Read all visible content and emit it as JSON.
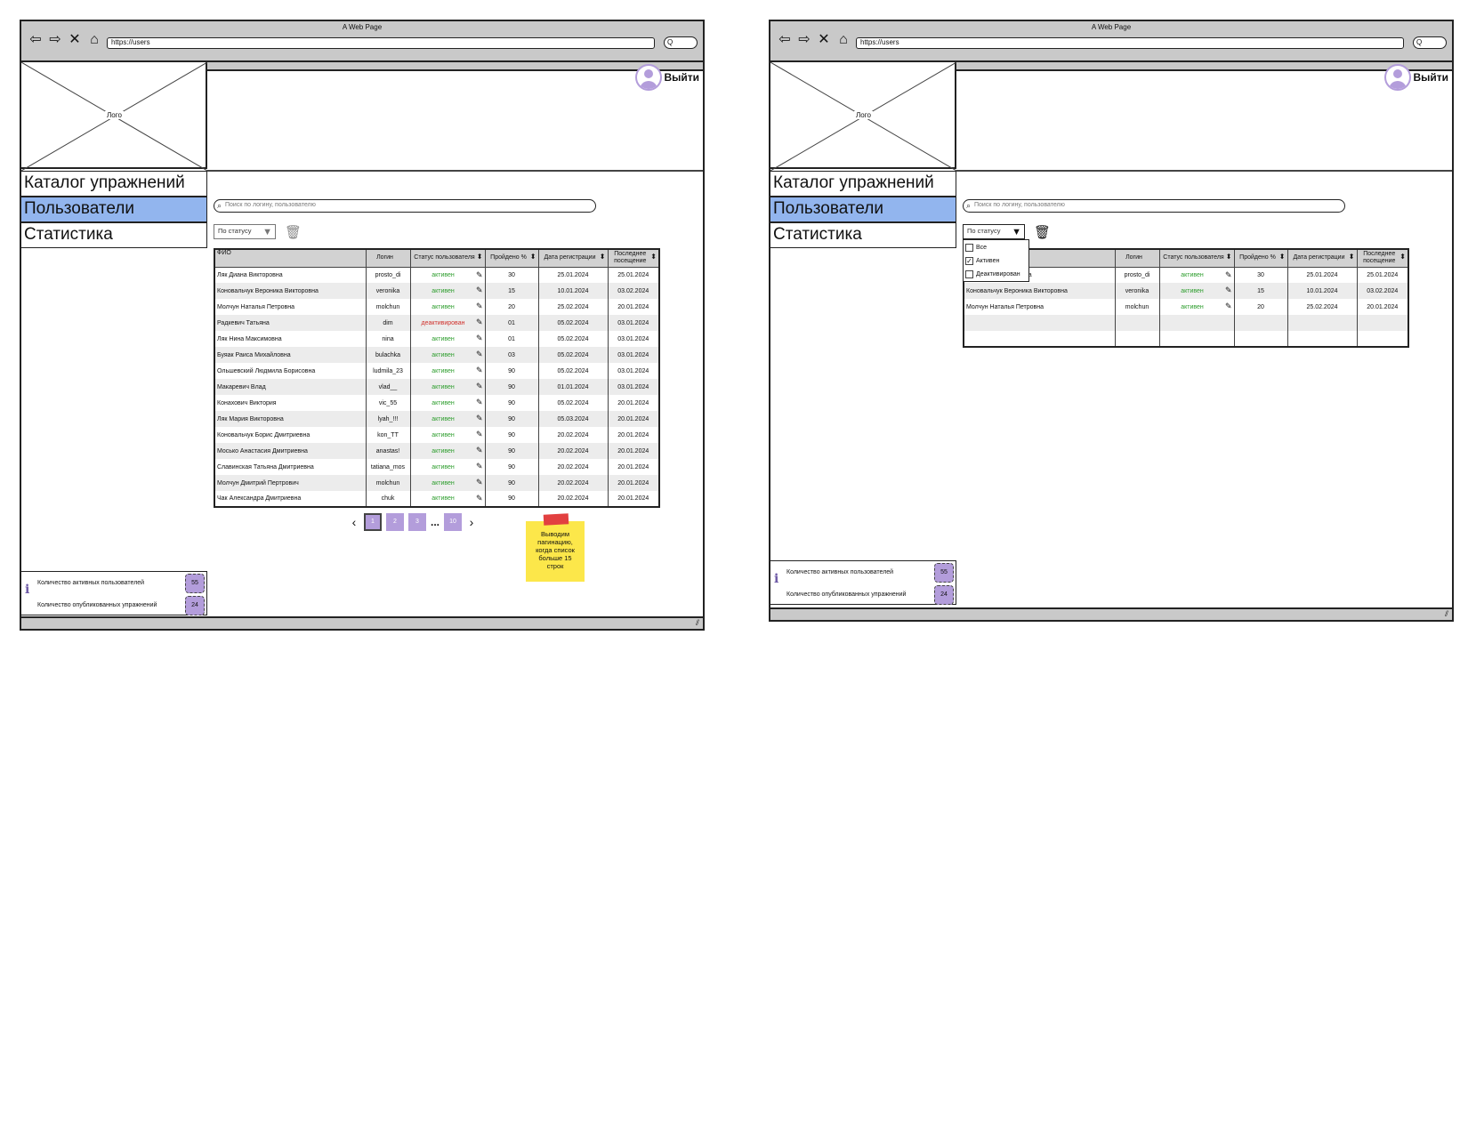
{
  "browser": {
    "title": "A Web Page",
    "url": "https://users",
    "search_glyph": "Q"
  },
  "header": {
    "logo_label": "Лого",
    "logout_label": "Выйти"
  },
  "sidebar": {
    "items": [
      {
        "label": "Каталог упражнений",
        "active": false
      },
      {
        "label": "Пользователи",
        "active": true
      },
      {
        "label": "Статистика",
        "active": false
      }
    ]
  },
  "toolbar": {
    "search_placeholder": "Поиск по логину, пользователю",
    "filter_label": "По статусу"
  },
  "table": {
    "columns": [
      "ФИО",
      "Логин",
      "Статус пользователя",
      "Пройдено %",
      "Дата регистрации",
      "Последнее посещение"
    ],
    "rows": [
      {
        "fio": "Ляк Диана Викторовна",
        "login": "prosto_di",
        "status": "активен",
        "done": "30",
        "reg": "25.01.2024",
        "last": "25.01.2024"
      },
      {
        "fio": "Коновальчук Вероника Викторовна",
        "login": "veronika",
        "status": "активен",
        "done": "15",
        "reg": "10.01.2024",
        "last": "03.02.2024"
      },
      {
        "fio": "Молчун Наталья Петровна",
        "login": "molchun",
        "status": "активен",
        "done": "20",
        "reg": "25.02.2024",
        "last": "20.01.2024"
      },
      {
        "fio": "Радкевич Татьяна",
        "login": "dim",
        "status": "деактивирован",
        "done": "01",
        "reg": "05.02.2024",
        "last": "03.01.2024"
      },
      {
        "fio": "Ляк Нина Максимовна",
        "login": "nina",
        "status": "активен",
        "done": "01",
        "reg": "05.02.2024",
        "last": "03.01.2024"
      },
      {
        "fio": "Буяак Раиса Михайловна",
        "login": "bulachka",
        "status": "активен",
        "done": "03",
        "reg": "05.02.2024",
        "last": "03.01.2024"
      },
      {
        "fio": "Ольшевский Людмила Борисовна",
        "login": "ludmila_23",
        "status": "активен",
        "done": "90",
        "reg": "05.02.2024",
        "last": "03.01.2024"
      },
      {
        "fio": "Макаревич Влад",
        "login": "vlad__",
        "status": "активен",
        "done": "90",
        "reg": "01.01.2024",
        "last": "03.01.2024"
      },
      {
        "fio": "Конахович Виктория",
        "login": "vic_55",
        "status": "активен",
        "done": "90",
        "reg": "05.02.2024",
        "last": "20.01.2024"
      },
      {
        "fio": "Ляк Мария Викторовна",
        "login": "lyah_!!!",
        "status": "активен",
        "done": "90",
        "reg": "05.03.2024",
        "last": "20.01.2024"
      },
      {
        "fio": "Коновальчук Борис Дмитриевна",
        "login": "kon_TT",
        "status": "активен",
        "done": "90",
        "reg": "20.02.2024",
        "last": "20.01.2024"
      },
      {
        "fio": "Мосько Анастасия Дмитриевна",
        "login": "anastas!",
        "status": "активен",
        "done": "90",
        "reg": "20.02.2024",
        "last": "20.01.2024"
      },
      {
        "fio": "Славинская Татьяна Дмитриевна",
        "login": "tatiana_mos",
        "status": "активен",
        "done": "90",
        "reg": "20.02.2024",
        "last": "20.01.2024"
      },
      {
        "fio": "Молчун Дмитрий Пертрович",
        "login": "molchun",
        "status": "активен",
        "done": "90",
        "reg": "20.02.2024",
        "last": "20.01.2024"
      },
      {
        "fio": "Чак Александра Дмитриевна",
        "login": "chuk",
        "status": "активен",
        "done": "90",
        "reg": "20.02.2024",
        "last": "20.01.2024"
      }
    ],
    "filtered_rows": [
      {
        "fio": "Ляк Диана Викторовна",
        "login": "prosto_di",
        "status": "активен",
        "done": "30",
        "reg": "25.01.2024",
        "last": "25.01.2024"
      },
      {
        "fio": "Коновальчук Вероника Викторовна",
        "login": "veronika",
        "status": "активен",
        "done": "15",
        "reg": "10.01.2024",
        "last": "03.02.2024"
      },
      {
        "fio": "Молчун Наталья Петровна",
        "login": "molchun",
        "status": "активен",
        "done": "20",
        "reg": "25.02.2024",
        "last": "20.01.2024"
      }
    ]
  },
  "pagination": {
    "pages": [
      "1",
      "2",
      "3",
      "10"
    ],
    "current": "1",
    "ellipsis": "...",
    "prev": "‹",
    "next": "›"
  },
  "note": {
    "text": "Выводим пагинацию, когда список больше 15 строк"
  },
  "info": {
    "active_users_label": "Количество активных пользователей",
    "active_users_value": "55",
    "published_label": "Количество опубликованных упражнений",
    "published_value": "24"
  },
  "status_filter": {
    "options": [
      {
        "label": "Все",
        "checked": false
      },
      {
        "label": "Активен",
        "checked": true
      },
      {
        "label": "Деактивирован",
        "checked": false
      }
    ]
  },
  "colors": {
    "active_menu": "#92b5ee",
    "accent": "#b39ddb",
    "status_active": "#2e9e2e",
    "status_inactive": "#d0302b",
    "sticky_note": "#fce74a"
  },
  "icons": [
    "back-icon",
    "forward-icon",
    "close-icon",
    "home-icon",
    "search-icon",
    "user-avatar-icon",
    "filter-icon",
    "trash-icon",
    "sort-icon",
    "edit-pencil-icon",
    "info-icon",
    "resize-grip-icon"
  ]
}
